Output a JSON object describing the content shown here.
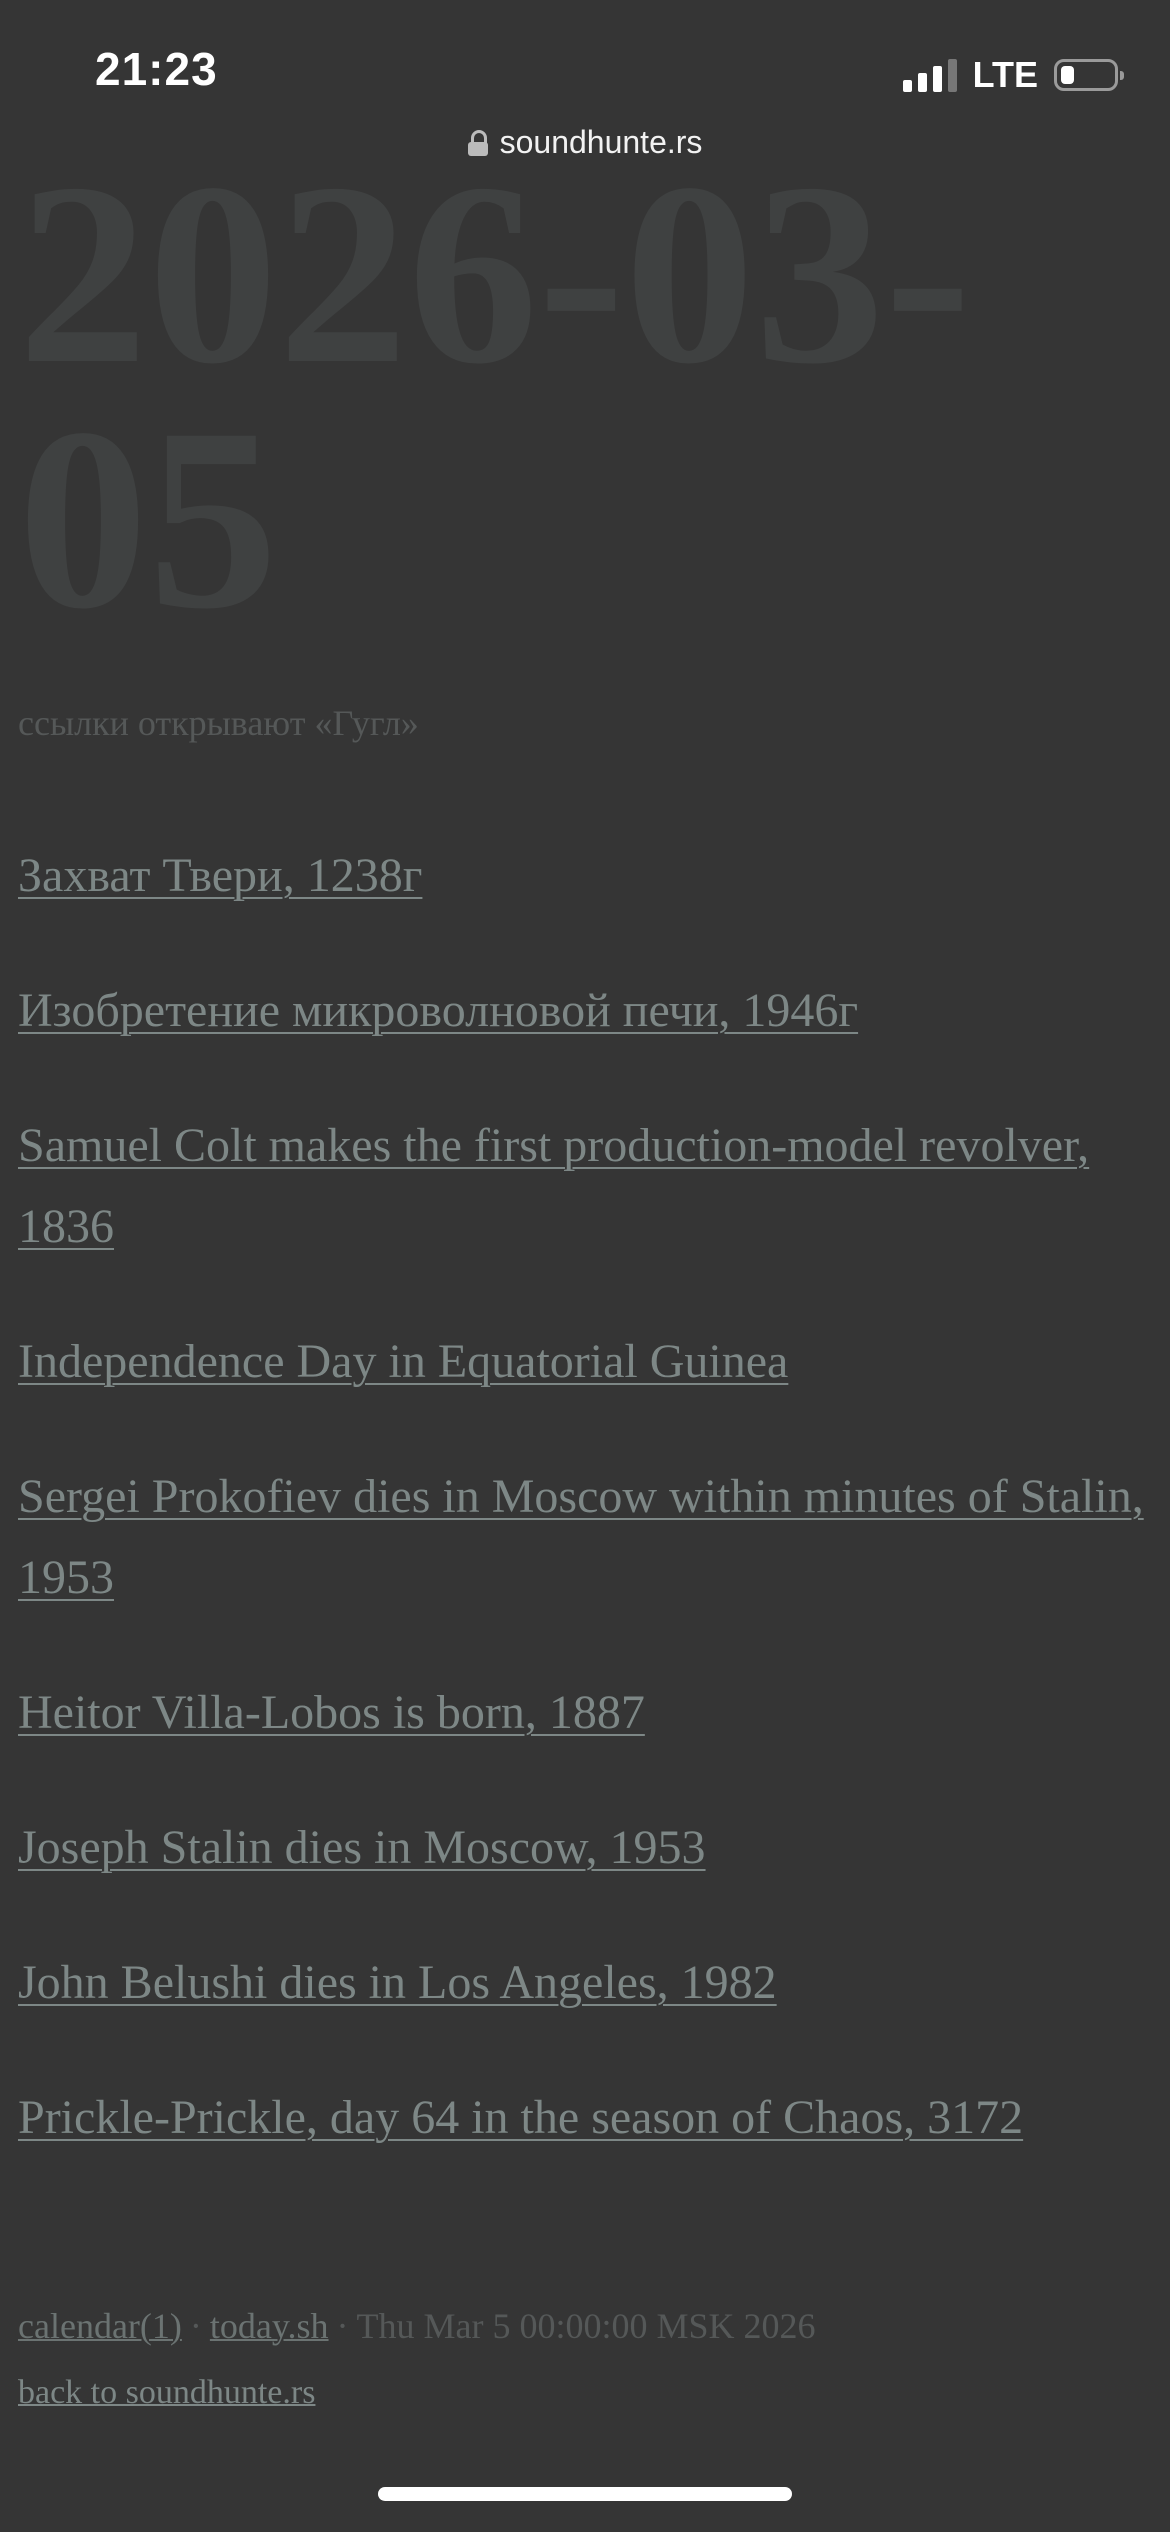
{
  "status_bar": {
    "time": "21:23",
    "network": "LTE",
    "signal_bars_active": 3,
    "signal_bars_total": 4,
    "battery_level": 0.25
  },
  "browser": {
    "url": "soundhunte.rs",
    "lock_icon": "lock-icon"
  },
  "page": {
    "date_heading": "2026-03-05",
    "subtitle": "ссылки открывают «Гугл»",
    "events": [
      "Захват Твери, 1238г",
      "Изобретение микроволновой печи, 1946г",
      "Samuel Colt makes the first production-model revolver, 1836",
      "Independence Day in Equatorial Guinea",
      "Sergei Prokofiev dies in Moscow within minutes of Stalin, 1953",
      "Heitor Villa-Lobos is born, 1887",
      "Joseph Stalin dies in Moscow, 1953",
      "John Belushi dies in Los Angeles, 1982",
      "Prickle-Prickle, day 64 in the season of Chaos, 3172"
    ],
    "footer": {
      "calendar_link": "calendar(1)",
      "separator": "·",
      "today_link": "today.sh",
      "timestamp": "Thu Mar 5 00:00:00 MSK 2026",
      "back_link": "back to soundhunte.rs"
    }
  },
  "colors": {
    "background": "#353535",
    "link": "#7d8786",
    "muted": "#555858",
    "date_watermark": "#3f4141"
  }
}
